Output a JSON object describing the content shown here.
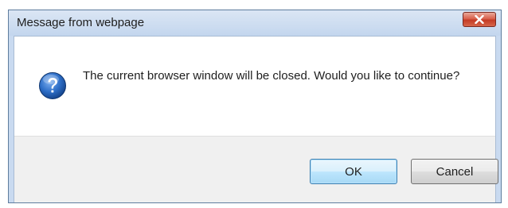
{
  "window": {
    "title": "Message from webpage"
  },
  "icons": {
    "close": "close-icon",
    "question": "question-icon"
  },
  "message": {
    "text": "The current browser window will be closed.  Would you like to continue?"
  },
  "buttons": {
    "ok_label": "OK",
    "cancel_label": "Cancel"
  },
  "colors": {
    "titlebar": "#c9daf0",
    "close_button": "#d04a33",
    "question_icon": "#1f5aa8",
    "ok_button_border": "#3c7fb1"
  }
}
